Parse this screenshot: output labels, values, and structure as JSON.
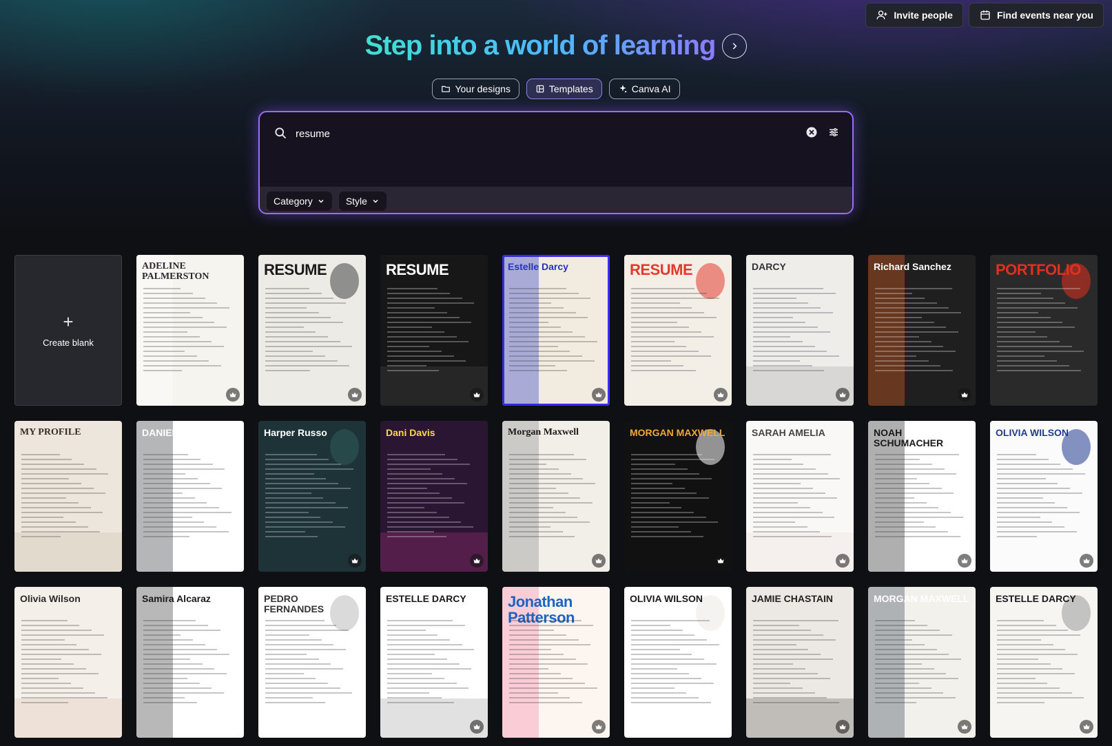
{
  "topbar": {
    "invite_label": "Invite people",
    "events_label": "Find events near you"
  },
  "hero": {
    "title": "Step into a world of learning"
  },
  "chips": [
    {
      "label": "Your designs",
      "icon": "folder-icon",
      "active": false
    },
    {
      "label": "Templates",
      "icon": "template-icon",
      "active": true
    },
    {
      "label": "Canva AI",
      "icon": "sparkle-icon",
      "active": false
    }
  ],
  "search": {
    "value": "resume",
    "placeholder": "",
    "filters": [
      {
        "label": "Category"
      },
      {
        "label": "Style"
      }
    ]
  },
  "grid": {
    "create_blank_label": "Create blank",
    "templates": [
      {
        "title": "ADELINE PALMERSTON",
        "bg": "#f6f4ef",
        "fg": "#2a2a2a",
        "accent": "#ffffff",
        "style": "serif",
        "premium": true
      },
      {
        "title": "RESUME",
        "bg": "#ecebe6",
        "fg": "#1a1a1a",
        "accent": "#444444",
        "style": "bold",
        "premium": true
      },
      {
        "title": "RESUME",
        "bg": "#171717",
        "fg": "#ffffff",
        "accent": "#555555",
        "style": "bold",
        "premium": true
      },
      {
        "title": "Estelle Darcy",
        "bg": "#f1ecdf",
        "fg": "#2530c8",
        "accent": "#2530c8",
        "style": "sans",
        "premium": true
      },
      {
        "title": "RESUME",
        "bg": "#f3efe7",
        "fg": "#e23b2e",
        "accent": "#e23b2e",
        "style": "bold",
        "premium": true
      },
      {
        "title": "DARCY",
        "bg": "#eeedea",
        "fg": "#333333",
        "accent": "#999999",
        "style": "sans",
        "premium": true
      },
      {
        "title": "Richard Sanchez",
        "bg": "#1f1f1f",
        "fg": "#ffffff",
        "accent": "#f26422",
        "style": "sans",
        "premium": true
      },
      {
        "title": "PORTFOLIO",
        "bg": "#2a2a2a",
        "fg": "#e0301e",
        "accent": "#e0301e",
        "style": "bold",
        "premium": false
      },
      {
        "title": "MY PROFILE",
        "bg": "#ece6dc",
        "fg": "#3a2e24",
        "accent": "#c9b8a5",
        "style": "serif",
        "premium": false
      },
      {
        "title": "DANIEL GALLEGO",
        "bg": "#ffffff",
        "fg": "#ffffff",
        "accent": "#2b2d33",
        "style": "sans",
        "premium": false
      },
      {
        "title": "Harper Russo",
        "bg": "#1e3338",
        "fg": "#ffffff",
        "accent": "#2f5b57",
        "style": "sans",
        "premium": true
      },
      {
        "title": "Dani Davis",
        "bg": "#2a1633",
        "fg": "#ffd84a",
        "accent": "#d0378f",
        "style": "sans",
        "premium": true
      },
      {
        "title": "Morgan Maxwell",
        "bg": "#f1efe8",
        "fg": "#1a1a1a",
        "accent": "#888888",
        "style": "serif",
        "premium": true
      },
      {
        "title": "MORGAN MAXWELL",
        "bg": "#111111",
        "fg": "#f2a93b",
        "accent": "#ffffff",
        "style": "sans",
        "premium": true
      },
      {
        "title": "SARAH AMELIA",
        "bg": "#faf8f6",
        "fg": "#444444",
        "accent": "#e8d8d4",
        "style": "sans",
        "premium": true
      },
      {
        "title": "NOAH SCHUMACHER",
        "bg": "#ffffff",
        "fg": "#1a1a1a",
        "accent": "#1a1a1a",
        "style": "sans",
        "premium": true
      },
      {
        "title": "OLIVIA WILSON",
        "bg": "#fbfbfb",
        "fg": "#1f3b8f",
        "accent": "#1f3b8f",
        "style": "sans",
        "premium": true
      },
      {
        "title": "Olivia Wilson",
        "bg": "#f4efe9",
        "fg": "#2a2a2a",
        "accent": "#d9b7a8",
        "style": "sans",
        "premium": false
      },
      {
        "title": "Samira Alcaraz",
        "bg": "#ffffff",
        "fg": "#1a1a1a",
        "accent": "#333333",
        "style": "sans",
        "premium": false
      },
      {
        "title": "PEDRO FERNANDES",
        "bg": "#ffffff",
        "fg": "#333333",
        "accent": "#bbbbbb",
        "style": "sans",
        "premium": false
      },
      {
        "title": "ESTELLE DARCY",
        "bg": "#ffffff",
        "fg": "#1a1a1a",
        "accent": "#888888",
        "style": "sans",
        "premium": true
      },
      {
        "title": "Jonathan Patterson",
        "bg": "#fdf6f0",
        "fg": "#1a64c6",
        "accent": "#f47fa4",
        "style": "bold",
        "premium": true
      },
      {
        "title": "OLIVIA WILSON",
        "bg": "#ffffff",
        "fg": "#1a1a1a",
        "accent": "#ede9e4",
        "style": "sans",
        "premium": false
      },
      {
        "title": "JAMIE CHASTAIN",
        "bg": "#ece8e3",
        "fg": "#222222",
        "accent": "#3b3b3b",
        "style": "sans",
        "premium": true
      },
      {
        "title": "MORGAN MAXWELL",
        "bg": "#f3f1ec",
        "fg": "#ffffff",
        "accent": "#2f3b4d",
        "style": "sans",
        "premium": true
      },
      {
        "title": "ESTELLE DARCY",
        "bg": "#f6f5f2",
        "fg": "#1a1a1a",
        "accent": "#999999",
        "style": "sans",
        "premium": true
      }
    ]
  }
}
